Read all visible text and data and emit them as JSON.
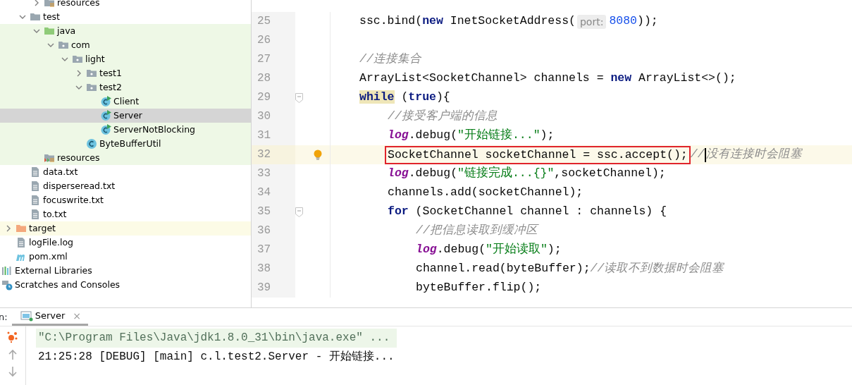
{
  "project_tree": [
    {
      "children": [
        {
          "children": [
            {
              "children": [
                {
                  "label": "resources",
                  "kind": "resources",
                  "expanded": false,
                  "selected": false
                }
              ]
            },
            {
              "label": "test",
              "kind": "folder",
              "expanded": true,
              "selected": false,
              "children": [
                {
                  "label": "java",
                  "kind": "test-source",
                  "expanded": true,
                  "test_scope": true,
                  "selected": false,
                  "children": [
                    {
                      "label": "com",
                      "kind": "package",
                      "expanded": true,
                      "test_scope": true,
                      "selected": false,
                      "children": [
                        {
                          "label": "light",
                          "kind": "package",
                          "expanded": true,
                          "test_scope": true,
                          "selected": false,
                          "children": [
                            {
                              "label": "test1",
                              "kind": "package",
                              "expanded": false,
                              "test_scope": true,
                              "selected": false
                            },
                            {
                              "label": "test2",
                              "kind": "package",
                              "expanded": true,
                              "test_scope": true,
                              "selected": false,
                              "children": [
                                {
                                  "label": "Client",
                                  "kind": "runnable-class",
                                  "test_scope": true,
                                  "selected": false
                                },
                                {
                                  "label": "Server",
                                  "kind": "runnable-class",
                                  "test_scope": true,
                                  "selected": true
                                },
                                {
                                  "label": "ServerNotBlocking",
                                  "kind": "runnable-class",
                                  "test_scope": true,
                                  "selected": false
                                }
                              ]
                            },
                            {
                              "label": "ByteBufferUtil",
                              "kind": "class",
                              "test_scope": true,
                              "selected": false
                            }
                          ]
                        }
                      ]
                    }
                  ]
                },
                {
                  "label": "resources",
                  "kind": "test-resources",
                  "test_scope": true,
                  "selected": false
                }
              ]
            },
            {
              "label": "data.txt",
              "kind": "file",
              "selected": false
            },
            {
              "label": "disperseread.txt",
              "kind": "file",
              "selected": false
            },
            {
              "label": "focuswrite.txt",
              "kind": "file",
              "selected": false
            },
            {
              "label": "to.txt",
              "kind": "file",
              "selected": false
            }
          ]
        },
        {
          "label": "target",
          "kind": "excluded-folder",
          "expanded": false,
          "excluded": true,
          "selected": false
        },
        {
          "label": "logFile.log",
          "kind": "file",
          "selected": false
        },
        {
          "label": "pom.xml",
          "kind": "maven",
          "selected": false
        }
      ]
    },
    {
      "label": "External Libraries",
      "kind": "libraries",
      "selected": false
    },
    {
      "label": "Scratches and Consoles",
      "kind": "scratches",
      "selected": false
    }
  ],
  "editor": {
    "lines": [
      {
        "number": "25",
        "kind": "statement",
        "segments": [
          {
            "kind": "code",
            "tokens": [
              {
                "kind": "plain",
                "text": "ssc.bind("
              },
              {
                "kind": "keyword",
                "text": "new"
              },
              {
                "kind": "plain",
                "text": " InetSocketAddress("
              }
            ]
          },
          {
            "kind": "hint",
            "text": "port:"
          },
          {
            "kind": "code",
            "tokens": [
              {
                "kind": "number",
                "text": "8080"
              },
              {
                "kind": "plain",
                "text": "));"
              }
            ]
          }
        ]
      },
      {
        "number": "26",
        "kind": "statement"
      },
      {
        "number": "27",
        "kind": "statement",
        "segments": [
          {
            "kind": "code",
            "tokens": [
              {
                "kind": "comment",
                "text": "//连接集合"
              }
            ]
          }
        ]
      },
      {
        "number": "28",
        "kind": "statement",
        "segments": [
          {
            "kind": "code",
            "tokens": [
              {
                "kind": "plain",
                "text": "ArrayList<SocketChannel> channels = "
              },
              {
                "kind": "keyword",
                "text": "new"
              },
              {
                "kind": "plain",
                "text": " ArrayList<>();"
              }
            ]
          }
        ]
      },
      {
        "number": "29",
        "kind": "statement",
        "fold": true,
        "segments": [
          {
            "kind": "code",
            "tokens": [
              {
                "kind": "keyword",
                "text": "while",
                "matched": true
              },
              {
                "kind": "plain",
                "text": " ("
              },
              {
                "kind": "keyword",
                "text": "true"
              },
              {
                "kind": "plain",
                "text": "){"
              }
            ]
          }
        ]
      },
      {
        "number": "30",
        "kind": "while-body",
        "segments": [
          {
            "kind": "code",
            "tokens": [
              {
                "kind": "comment",
                "text": "//接受客户端的信息"
              }
            ]
          }
        ]
      },
      {
        "number": "31",
        "kind": "while-body",
        "segments": [
          {
            "kind": "code",
            "tokens": [
              {
                "kind": "field",
                "text": "log"
              },
              {
                "kind": "plain",
                "text": ".debug("
              },
              {
                "kind": "string",
                "text": "\"开始链接...\""
              },
              {
                "kind": "plain",
                "text": ");"
              }
            ]
          }
        ]
      },
      {
        "number": "32",
        "kind": "while-body",
        "current": true,
        "bulb": true,
        "segments": [
          {
            "kind": "boxed",
            "tokens": [
              {
                "kind": "plain",
                "text": "SocketChannel socketChannel = ssc.accept();"
              }
            ]
          },
          {
            "kind": "code",
            "tokens": [
              {
                "kind": "comment",
                "text": "//"
              }
            ]
          },
          {
            "kind": "caret"
          },
          {
            "kind": "code",
            "tokens": [
              {
                "kind": "comment",
                "text": "没有连接时会阻塞"
              }
            ]
          }
        ]
      },
      {
        "number": "33",
        "kind": "while-body",
        "segments": [
          {
            "kind": "code",
            "tokens": [
              {
                "kind": "field",
                "text": "log"
              },
              {
                "kind": "plain",
                "text": ".debug("
              },
              {
                "kind": "string",
                "text": "\"链接完成...{}\""
              },
              {
                "kind": "plain",
                "text": ",socketChannel);"
              }
            ]
          }
        ]
      },
      {
        "number": "34",
        "kind": "while-body",
        "segments": [
          {
            "kind": "code",
            "tokens": [
              {
                "kind": "plain",
                "text": "channels.add(socketChannel);"
              }
            ]
          }
        ]
      },
      {
        "number": "35",
        "kind": "while-body",
        "fold": true,
        "segments": [
          {
            "kind": "code",
            "tokens": [
              {
                "kind": "keyword",
                "text": "for"
              },
              {
                "kind": "plain",
                "text": " (SocketChannel channel : channels) {"
              }
            ]
          }
        ]
      },
      {
        "number": "36",
        "kind": "for-body",
        "segments": [
          {
            "kind": "code",
            "tokens": [
              {
                "kind": "comment",
                "text": "//把信息读取到缓冲区"
              }
            ]
          }
        ]
      },
      {
        "number": "37",
        "kind": "for-body",
        "segments": [
          {
            "kind": "code",
            "tokens": [
              {
                "kind": "field",
                "text": "log"
              },
              {
                "kind": "plain",
                "text": ".debug("
              },
              {
                "kind": "string",
                "text": "\"开始读取\""
              },
              {
                "kind": "plain",
                "text": ");"
              }
            ]
          }
        ]
      },
      {
        "number": "38",
        "kind": "for-body",
        "segments": [
          {
            "kind": "code",
            "tokens": [
              {
                "kind": "plain",
                "text": "channel.read(byteBuffer);"
              },
              {
                "kind": "comment",
                "text": "//读取不到数据时会阻塞"
              }
            ]
          }
        ]
      },
      {
        "number": "39",
        "kind": "for-body",
        "segments": [
          {
            "kind": "code",
            "tokens": [
              {
                "kind": "plain",
                "text": "byteBuffer.flip();"
              }
            ]
          }
        ]
      }
    ]
  },
  "run_panel": {
    "label": "n:",
    "tabs": [
      {
        "label": "Server",
        "close": "×",
        "selected": true
      }
    ],
    "console": [
      {
        "kind": "command",
        "text": "\"C:\\Program Files\\Java\\jdk1.8.0_31\\bin\\java.exe\" ..."
      },
      {
        "kind": "output",
        "text": "21:25:28 [DEBUG] [main] c.l.test2.Server - 开始链接..."
      }
    ]
  }
}
